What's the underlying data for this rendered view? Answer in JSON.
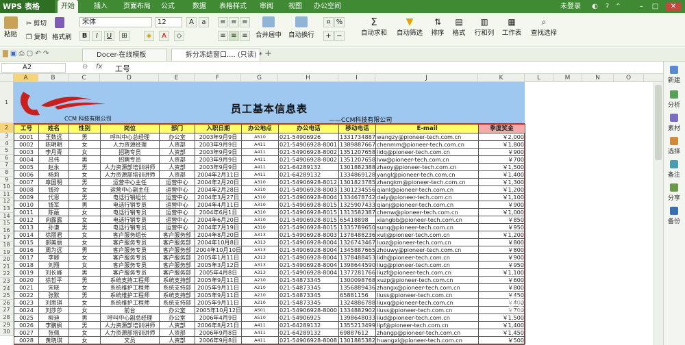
{
  "app": {
    "name": "WPS 表格",
    "login": "未登录"
  },
  "menu": [
    "开始",
    "插入",
    "页面布局",
    "公式",
    "数据",
    "表格样式",
    "审阅",
    "视图",
    "办公空间"
  ],
  "ribbon": {
    "paste": "粘贴",
    "cut": "剪切",
    "copy": "复制",
    "format_painter": "格式刷",
    "font": "宋体",
    "size": "12",
    "merge": "合并居中",
    "wrap": "自动换行",
    "autosum": "自动求和",
    "autofilter": "自动筛选",
    "sort": "排序",
    "format": "格式",
    "rowcol": "行和列",
    "sheet": "工作表",
    "findsel": "查找选择"
  },
  "tabs": [
    {
      "label": "Docer-在线模板"
    },
    {
      "label": "拆分冻结窗口.... (只读) *"
    }
  ],
  "formula": {
    "cellref": "A2",
    "fx": "fx",
    "value": "工号"
  },
  "columns": [
    "A",
    "B",
    "C",
    "D",
    "E",
    "F",
    "G",
    "H",
    "I",
    "J",
    "K",
    "L",
    "M",
    "N",
    "O"
  ],
  "sheet": {
    "title": "员工基本信息表",
    "subtitle": "——CCM科技有限公司",
    "logo_text": "CCM 科技有限公司"
  },
  "headers": [
    "工号",
    "姓名",
    "性别",
    "岗位",
    "部门",
    "入职日期",
    "办公地点",
    "办公电话",
    "移动电话",
    "E-mail",
    "季度奖金"
  ],
  "rows": [
    [
      "0001",
      "王数远",
      "男",
      "呼叫中心总经理",
      "办公室",
      "2003年9月9日",
      "A510",
      "021-54906926",
      "13317348876",
      "wangzy@pioneer-tech.com.cn",
      "￥2,000"
    ],
    [
      "0002",
      "陈明明",
      "女",
      "人力资源经理",
      "人资部",
      "2003年9月9日",
      "A411",
      "021-54906928-8001",
      "13898876678",
      "chenmm@pioneer-tech.com.cn",
      "￥1,800"
    ],
    [
      "0003",
      "李月青",
      "女",
      "招聘专员",
      "人资部",
      "2003年9月9日",
      "A411",
      "021-54906928-8002",
      "13512076589",
      "lidq@pioneer-tech.com.cn",
      "￥900"
    ],
    [
      "0004",
      "吕伟",
      "男",
      "招聘专员",
      "人资部",
      "2003年9月9日",
      "A411",
      "021-54906928-8002",
      "13512076583",
      "lvw@pioneer-tech.com.cn",
      "￥700"
    ],
    [
      "0005",
      "赵永",
      "男",
      "人力资源部培训讲师",
      "人资部",
      "2003年9月9日",
      "A411",
      "021-64289132",
      "13018823888",
      "zhaoy@pioneer-tech.com.cn",
      "￥1,500"
    ],
    [
      "0006",
      "杨莉",
      "女",
      "人力资源部培训讲师",
      "人资部",
      "2004年2月11日",
      "A411",
      "021-64289132",
      "13348691286",
      "yangl@pioneer-tech.com.cn",
      "￥1,400"
    ],
    [
      "0007",
      "章国明",
      "男",
      "运营中心主任",
      "运营中心",
      "2004年2月20日",
      "A310",
      "021-54906928-8012",
      "13018237858",
      "zhangkm@pioneer-tech.com.cn",
      "￥1,300"
    ],
    [
      "0008",
      "钱玲",
      "女",
      "运营中心副主任",
      "运营中心",
      "2004年2月28日",
      "A310",
      "021-54906928-8003",
      "13012345568",
      "qianl@pioneer-tech.com.cn",
      "￥1,200"
    ],
    [
      "0009",
      "代恩",
      "男",
      "电话行销组长",
      "运营中心",
      "2004年3月27日",
      "A310",
      "021-54906928-8004",
      "13346787422",
      "daiy@pioneer-tech.com.cn",
      "￥1,100"
    ],
    [
      "0010",
      "钱军",
      "男",
      "电话行销专员",
      "运营中心",
      "2004年4月11日",
      "A310",
      "021-54906928-8015",
      "13259074338",
      "qianj@pioneer-tech.com.cn",
      "￥900"
    ],
    [
      "0011",
      "陈蔽",
      "女",
      "电话行销专员",
      "运营中心",
      "2004年6月1日",
      "A310",
      "021-54906928-8015",
      "13135823870",
      "chenw@pioneer-tech.com.cn",
      "￥1,000"
    ],
    [
      "0012",
      "向露露",
      "女",
      "电话行销专员",
      "运营中心",
      "2004年6月20日",
      "A310",
      "021-54906928-8015",
      "65418898",
      "xiangbb@pioneer-tech.com.cn",
      "￥850"
    ],
    [
      "0013",
      "孙谦",
      "男",
      "电话行销专员",
      "运营中心",
      "2004年7月19日",
      "A310",
      "021-54906928-8015",
      "13357896502",
      "sunq@pioneer-tech.com.cn",
      "￥950"
    ],
    [
      "0014",
      "徐丽君",
      "女",
      "客户服务组长",
      "客户服务部",
      "2004年8月20日",
      "A313",
      "021-54906928-8003",
      "13784882366",
      "xulj@pioneer-tech.com.cn",
      "￥1,200"
    ],
    [
      "0015",
      "郝美丽",
      "女",
      "客户服务专员",
      "客户服务部",
      "2004年10月8日",
      "A313",
      "021-54906928-8004",
      "13267434678",
      "luoz@pioneer-tech.com.cn",
      "￥800"
    ],
    [
      "0016",
      "周为远",
      "男",
      "客户服务专员",
      "客户服务部",
      "2004年10月10日",
      "A313",
      "021-54906928-8004",
      "13458876656",
      "zhouwy@pioneer-tech.com.cn",
      "￥800"
    ],
    [
      "0017",
      "李卿",
      "女",
      "客户服务专员",
      "客户服务部",
      "2005年1月11日",
      "A313",
      "021-54906928-8004",
      "13784884532",
      "lidh@pioneer-tech.com.cn",
      "￥900"
    ],
    [
      "0018",
      "刘翔",
      "女",
      "客户服务专员",
      "客户服务部",
      "2005年3月12日",
      "A313",
      "021-54906928-8004",
      "13986445902",
      "liug@pioneer-tech.com.cn",
      "￥950"
    ],
    [
      "0019",
      "刘长峰",
      "男",
      "客户服务专员",
      "客户服务部",
      "2005年4月8日",
      "A313",
      "021-54906928-8004",
      "13772817665",
      "liuzf@pioneer-tech.com.cn",
      "￥1,100"
    ],
    [
      "0020",
      "徐哲平",
      "男",
      "系统支持工程师",
      "系统支持部",
      "2005年9月11日",
      "A210",
      "021-54873345",
      "13000987685",
      "xuzp@pioneer-tech.com.cn",
      "￥600"
    ],
    [
      "0021",
      "宋晓",
      "女",
      "系统维护工程师",
      "系统支持部",
      "2005年9月11日",
      "A210",
      "021-54873345",
      "13568894365",
      "zhangx@pioneer-tech.com.cn",
      "￥800"
    ],
    [
      "0022",
      "张默",
      "男",
      "系统维护工程师",
      "系统支持部",
      "2005年9月11日",
      "A210",
      "021-54873345",
      "65881156",
      "liuss@pioneer-tech.com.cn",
      "￥450"
    ],
    [
      "0023",
      "刘思琪",
      "女",
      "系统维护工程师",
      "系统支持部",
      "2005年9月11日",
      "A210",
      "021-54873345",
      "13248867889",
      "liuxq@pioneer-tech.com.cn",
      "￥400"
    ],
    [
      "0024",
      "刘莎莎",
      "女",
      "前台",
      "办公室",
      "2005年10月12日",
      "A501",
      "021-54906928-8000",
      "13348829028",
      "liuss@pioneer-tech.com.cn",
      "￥700"
    ],
    [
      "0025",
      "柳迪",
      "男",
      "呼叫中心副总经理",
      "办公室",
      "2006年4月9日",
      "A510",
      "021-54906925",
      "13986480332",
      "liud@pioneer-tech.com.cn",
      "￥1,500"
    ],
    [
      "0026",
      "李鹏枫",
      "男",
      "人力资源部培训讲师",
      "人资部",
      "2006年8月21日",
      "A411",
      "021-64289132",
      "13552134998",
      "lipf@pioneer-tech.com.cn",
      "￥1,400"
    ],
    [
      "0027",
      "张佩",
      "女",
      "人力资源部培训讲师",
      "人资部",
      "2006年9月8日",
      "A411",
      "021-64289132",
      "69887612",
      "zhangp@pioneer-tech.com.cn",
      "￥1,450"
    ],
    [
      "0028",
      "黄晓琪",
      "女",
      "文员",
      "人资部",
      "2006年9月8日",
      "A411",
      "021-54906928-8008",
      "13018853823",
      "huangxl@pioneer-tech.com.cn",
      "￥500"
    ]
  ],
  "sidebar": [
    "新建",
    "分析",
    "素材",
    "选择",
    "备注",
    "分享",
    "备份"
  ],
  "watermark": {
    "main": "Baidu 经验",
    "sub": "jingyan.baidu.com"
  },
  "colors": {
    "titlebar": "#3f8a33",
    "header_band": "#9ec8ef",
    "header_yellow": "#ffff66",
    "bonus_pink": "#f5a9a9"
  }
}
